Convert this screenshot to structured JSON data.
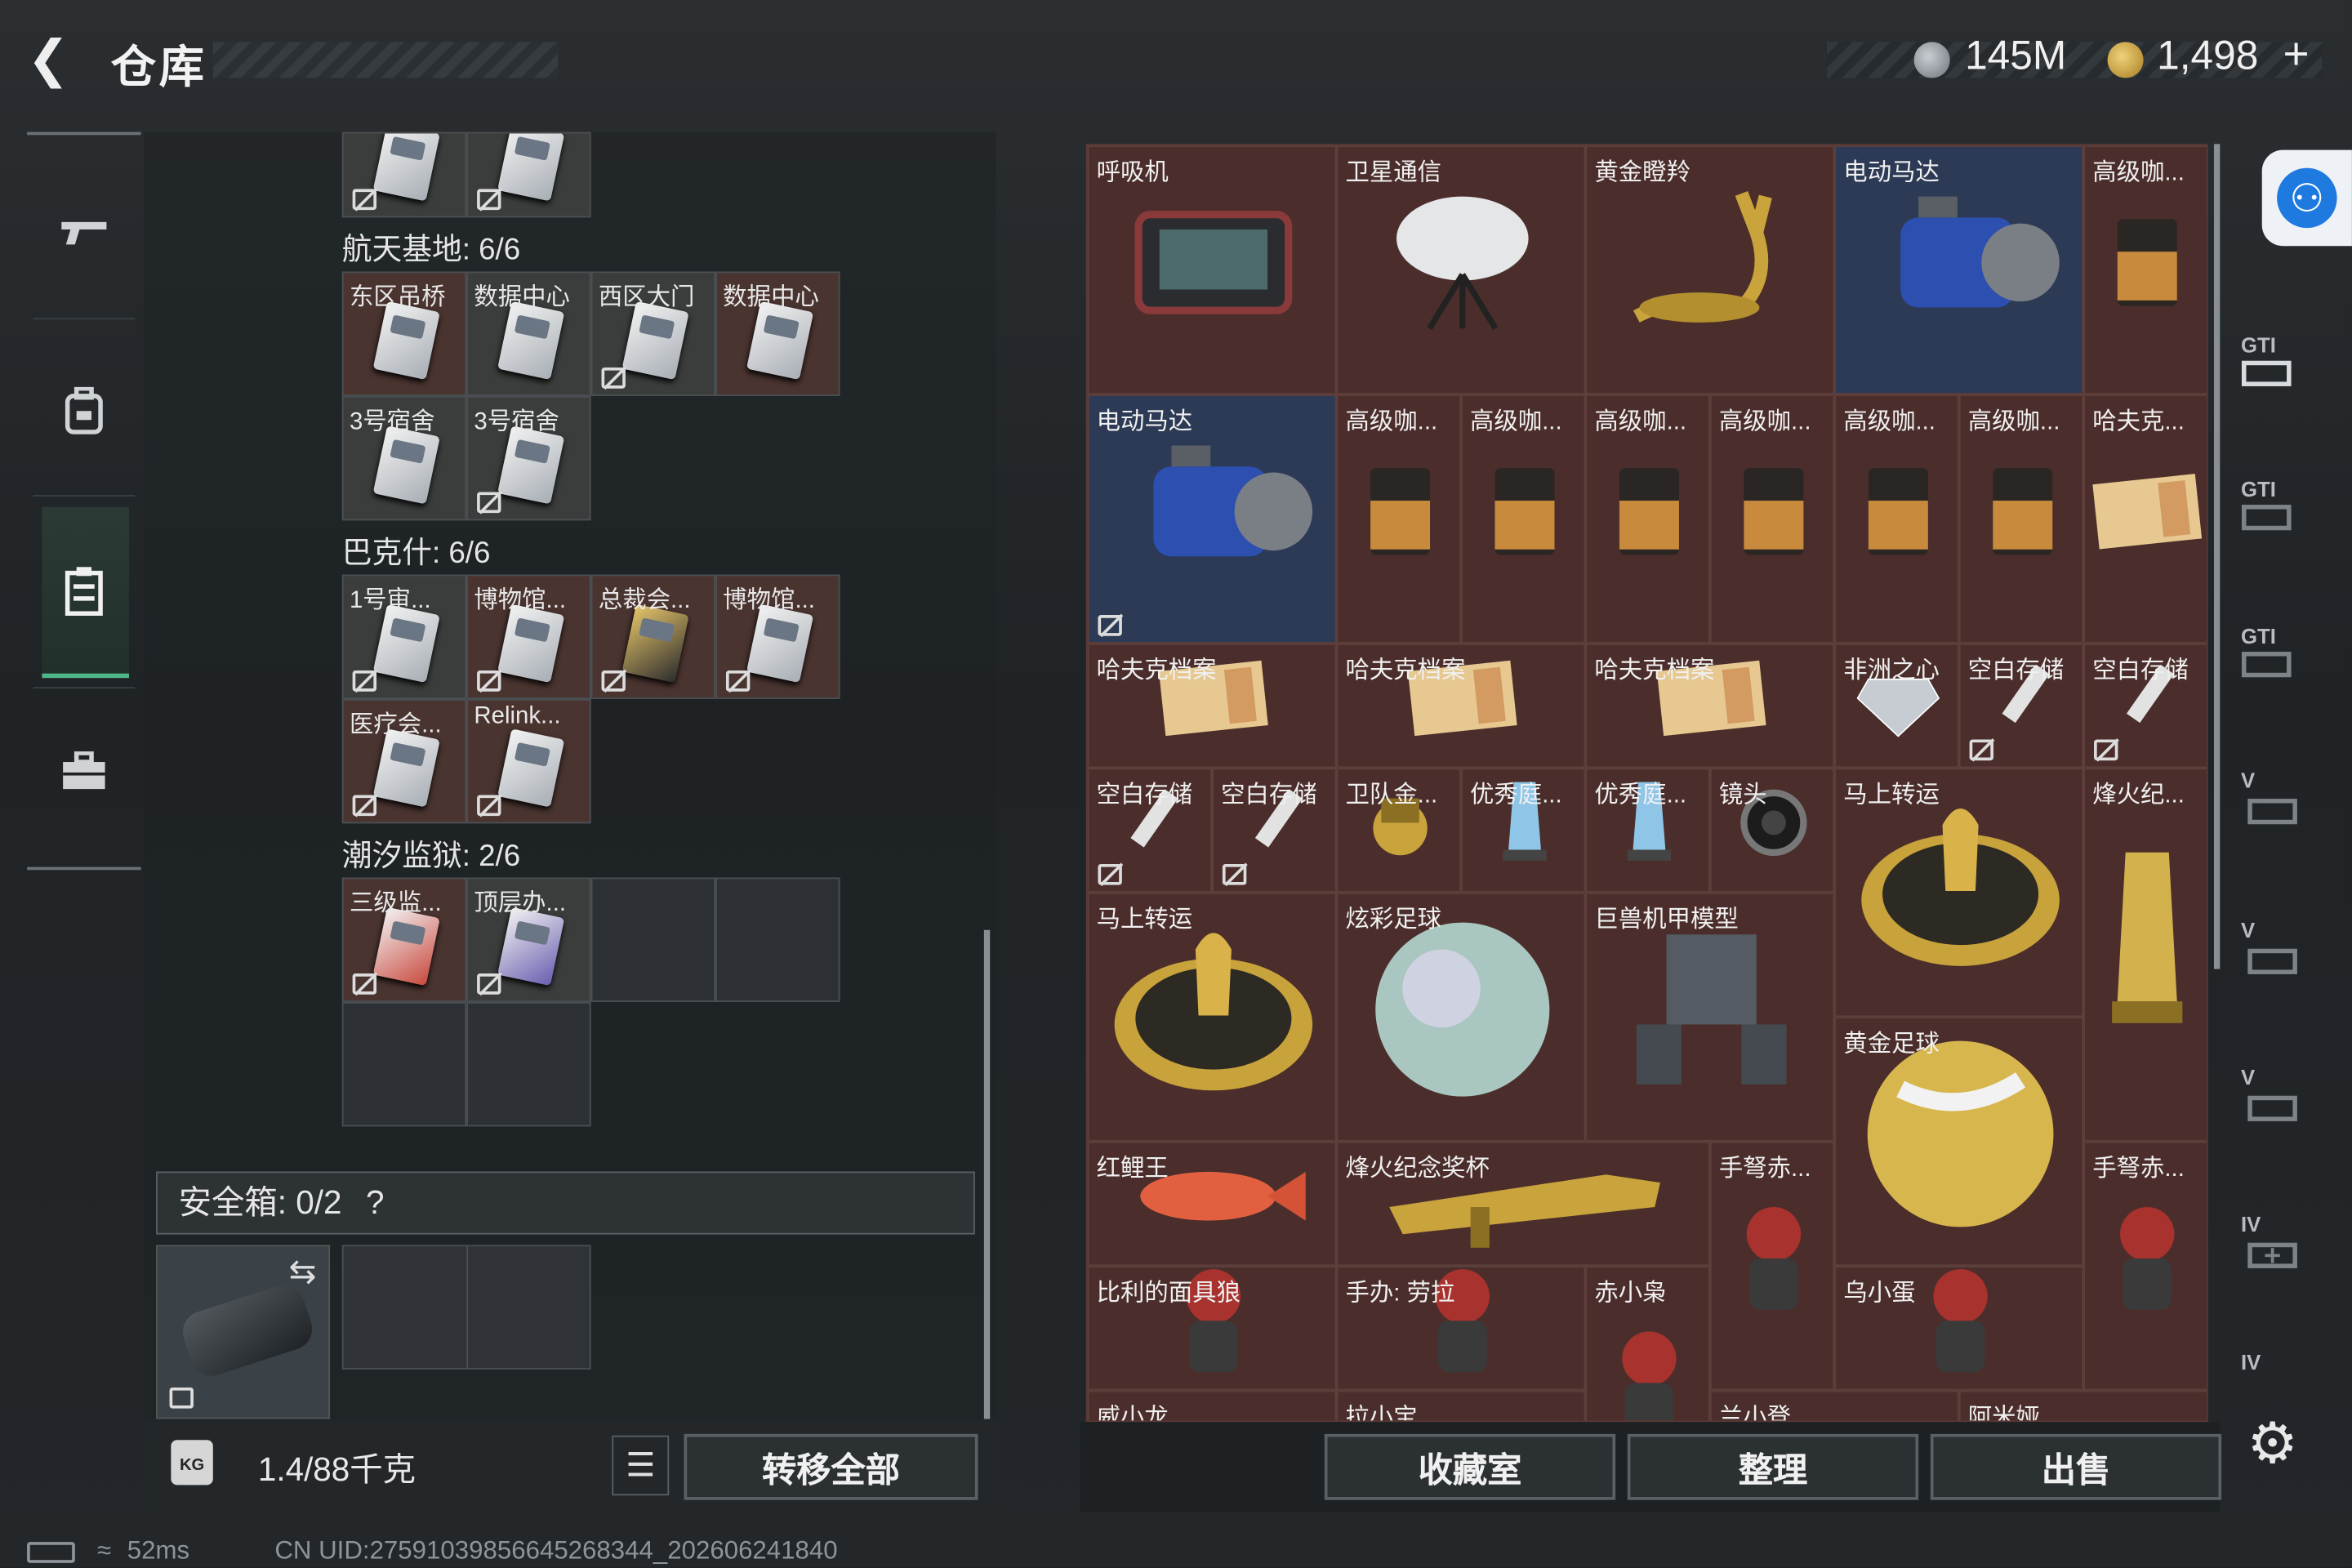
{
  "header": {
    "back_icon": "chevron-left-icon",
    "title": "仓库",
    "currency1": "145M",
    "currency2": "1,498",
    "add_label": "+"
  },
  "nav": [
    "rifle-icon",
    "backpack-icon",
    "warehouse-icon",
    "toolbox-icon"
  ],
  "grid": {
    "top_partial": [
      {
        "label": ""
      },
      {
        "label": ""
      }
    ],
    "sections": [
      {
        "title": "航天基地: 6/6",
        "cells": [
          "东区吊桥",
          "数据中心",
          "西区大门",
          "数据中心",
          "3号宿舍",
          "3号宿舍"
        ]
      },
      {
        "title": "巴克什: 6/6",
        "cells": [
          "1号审...",
          "博物馆...",
          "总裁会...",
          "博物馆...",
          "医疗会...",
          "Relink..."
        ]
      },
      {
        "title": "潮汐监狱: 2/6",
        "cells": [
          "三级监...",
          "顶层办..."
        ]
      }
    ]
  },
  "safe": {
    "label": "安全箱:  0/2",
    "help": "?"
  },
  "bottom_left": {
    "weight": "1.4/88千克",
    "kg_icon": "KG",
    "transfer_all": "转移全部"
  },
  "items": [
    {
      "label": "呼吸机"
    },
    {
      "label": "卫星通信"
    },
    {
      "label": "黄金瞪羚"
    },
    {
      "label": "电动马达"
    },
    {
      "label": "高级咖..."
    },
    {
      "label": "电动马达"
    },
    {
      "label": "高级咖..."
    },
    {
      "label": "高级咖..."
    },
    {
      "label": "高级咖..."
    },
    {
      "label": "高级咖..."
    },
    {
      "label": "高级咖..."
    },
    {
      "label": "高级咖..."
    },
    {
      "label": "哈夫克..."
    },
    {
      "label": "哈夫克档案"
    },
    {
      "label": "哈夫克档案"
    },
    {
      "label": "哈夫克档案"
    },
    {
      "label": "非洲之心"
    },
    {
      "label": "空白存储"
    },
    {
      "label": "空白存储"
    },
    {
      "label": "空白存储"
    },
    {
      "label": "空白存储"
    },
    {
      "label": "卫队金..."
    },
    {
      "label": "优秀庭..."
    },
    {
      "label": "优秀庭..."
    },
    {
      "label": "镜头"
    },
    {
      "label": "马上转运"
    },
    {
      "label": "烽火纪..."
    },
    {
      "label": "马上转运"
    },
    {
      "label": "炫彩足球"
    },
    {
      "label": "巨兽机甲模型"
    },
    {
      "label": "黄金足球"
    },
    {
      "label": "红鲤王"
    },
    {
      "label": "烽火纪念奖杯"
    },
    {
      "label": "手弩赤..."
    },
    {
      "label": "手弩赤..."
    },
    {
      "label": "比利的面具狼"
    },
    {
      "label": "手办: 劳拉"
    },
    {
      "label": "赤小枭"
    },
    {
      "label": "乌小蛋"
    },
    {
      "label": "威小龙"
    },
    {
      "label": "拉小宝"
    },
    {
      "label": "兰小登"
    },
    {
      "label": "阿米娅"
    }
  ],
  "bottom_right": {
    "collection": "收藏室",
    "organize": "整理",
    "sell": "出售"
  },
  "sidebar_right": [
    "GTI",
    "GTI",
    "GTI",
    "V",
    "V",
    "V",
    "IV",
    "IV"
  ],
  "status": {
    "ping": "52ms",
    "uid": "CN UID:27591039856645268344_202606241840"
  },
  "colors": {
    "accent": "#4fb88a",
    "rare_red": "#4b2e2b",
    "rare_blue": "#2c3a55"
  }
}
